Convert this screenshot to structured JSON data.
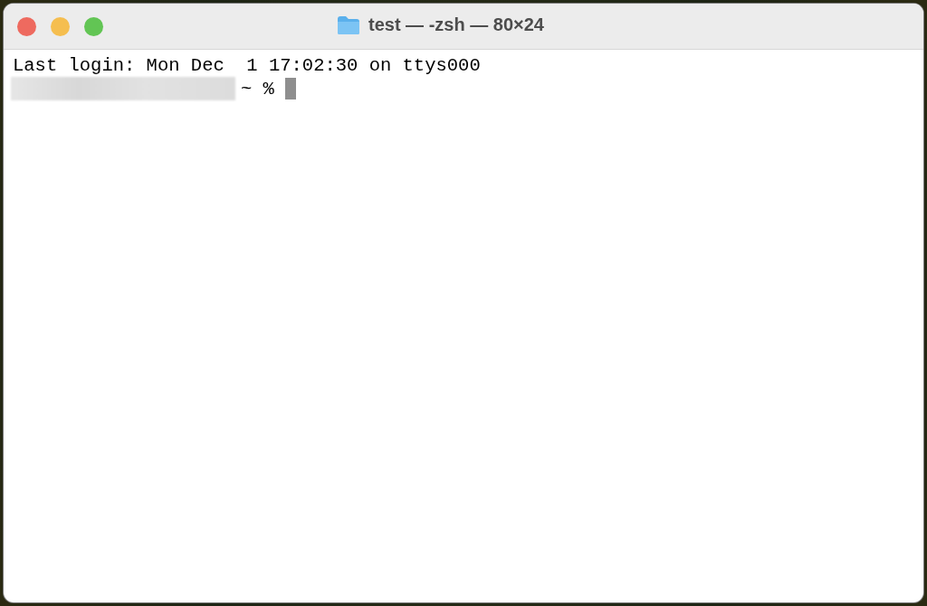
{
  "window": {
    "title": "test — -zsh — 80×24",
    "controls": [
      {
        "kind": "close"
      },
      {
        "kind": "minimize"
      },
      {
        "kind": "zoom"
      }
    ]
  },
  "terminal": {
    "lines": [
      {
        "kind": "output",
        "text": "Last login: Mon Dec  1 17:02:30 on ttys000"
      },
      {
        "kind": "prompt",
        "redacted": true,
        "text": "~ %",
        "cursor": true
      }
    ]
  }
}
